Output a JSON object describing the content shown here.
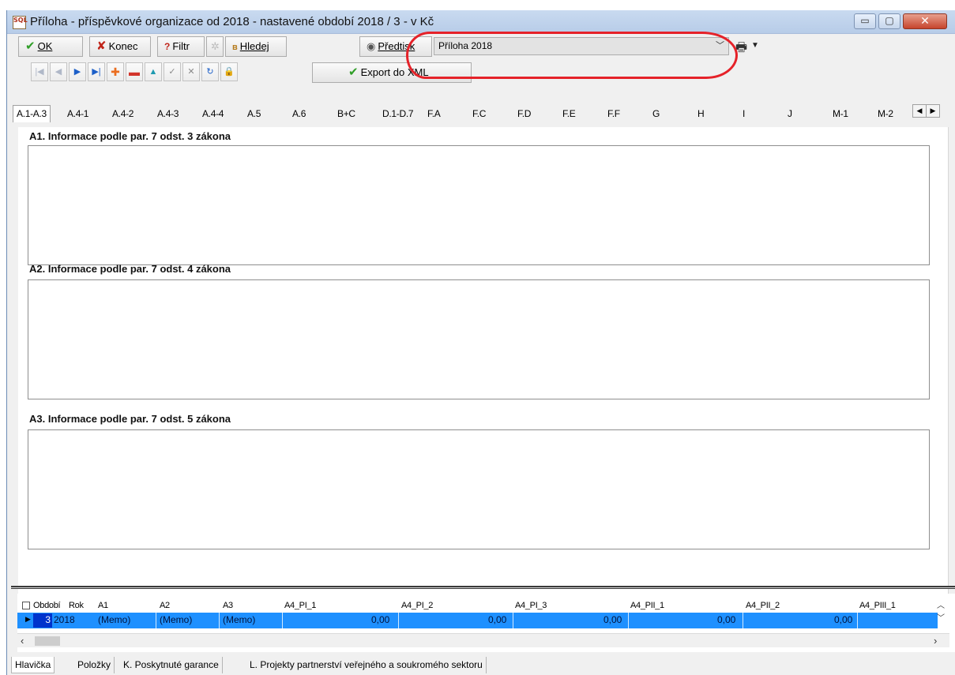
{
  "window": {
    "title": "Příloha - příspěvkové organizace od 2018 - nastavené období 2018 / 3 - v Kč",
    "app_icon_text": "SQL",
    "min_symbol": "▭",
    "max_symbol": "▢",
    "close_symbol": "✕"
  },
  "toolbar": {
    "ok_label": "OK",
    "konec_label": "Konec",
    "filtr_label": "Filtr",
    "hledej_label": "Hledej",
    "predtisk_label": "Předtisk",
    "report_selected": "Příloha 2018",
    "export_label": "Export do XML"
  },
  "tabs": [
    "A.4-1",
    "A.4-2",
    "A.4-3",
    "A.4-4",
    "A.5",
    "A.6",
    "B+C",
    "D.1-D.7",
    "F.A",
    "F.C",
    "F.D",
    "F.E",
    "F.F",
    "G",
    "H",
    "I",
    "J",
    "M-1",
    "M-2"
  ],
  "active_tab": "A.1-A.3",
  "sections": [
    {
      "label": "A1. Informace podle par. 7 odst. 3 zákona",
      "value": ""
    },
    {
      "label": "A2. Informace podle par. 7 odst. 4 zákona",
      "value": ""
    },
    {
      "label": "A3. Informace podle par. 7 odst. 5 zákona",
      "value": ""
    }
  ],
  "grid": {
    "columns": [
      "Období",
      "Rok",
      "A1",
      "A2",
      "A3",
      "A4_PI_1",
      "A4_PI_2",
      "A4_PI_3",
      "A4_PII_1",
      "A4_PII_2",
      "A4_PIII_1"
    ],
    "row": {
      "obdobi": "3",
      "rok": "2018",
      "a1": "(Memo)",
      "a2": "(Memo)",
      "a3": "(Memo)",
      "a4_pi_1": "0,00",
      "a4_pi_2": "0,00",
      "a4_pi_3": "0,00",
      "a4_pii_1": "0,00",
      "a4_pii_2": "0,00",
      "a4_piii_1": ""
    }
  },
  "bottom_tabs": [
    "Hlavička",
    "Položky",
    "K. Poskytnuté garance",
    "L. Projekty partnerství veřejného a soukromého sektoru"
  ],
  "colors": {
    "annotation": "#e52229",
    "selected_row": "#1e90ff",
    "selected_cell": "#0033cc"
  }
}
